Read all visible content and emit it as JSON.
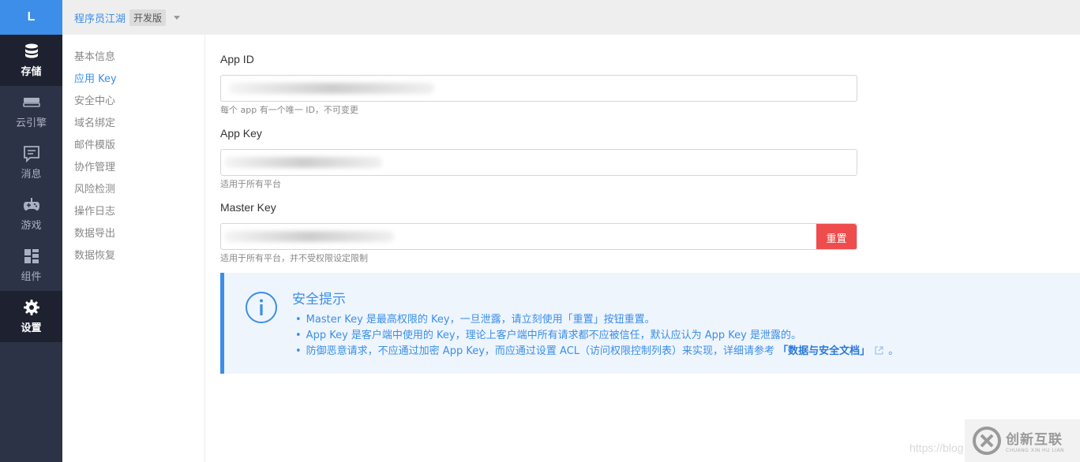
{
  "rail": {
    "logo": "L",
    "items": [
      {
        "label": "存储",
        "icon": "database-icon",
        "active": true
      },
      {
        "label": "云引擎",
        "icon": "cloud-engine-icon",
        "active": false
      },
      {
        "label": "消息",
        "icon": "message-icon",
        "active": false
      },
      {
        "label": "游戏",
        "icon": "gamepad-icon",
        "active": false
      },
      {
        "label": "组件",
        "icon": "components-icon",
        "active": false
      },
      {
        "label": "设置",
        "icon": "gear-icon",
        "active": true
      }
    ]
  },
  "topbar": {
    "app_name": "程序员江湖",
    "plan_badge": "开发版"
  },
  "subnav": {
    "items": [
      "基本信息",
      "应用 Key",
      "安全中心",
      "域名绑定",
      "邮件模版",
      "协作管理",
      "风险检测",
      "操作日志",
      "数据导出",
      "数据恢复"
    ],
    "active": "应用 Key"
  },
  "fields": {
    "app_id": {
      "label": "App ID",
      "help": "每个 app 有一个唯一 ID，不可变更"
    },
    "app_key": {
      "label": "App Key",
      "help": "适用于所有平台"
    },
    "master_key": {
      "label": "Master Key",
      "help": "适用于所有平台，并不受权限设定限制",
      "reset_label": "重置"
    }
  },
  "security_tip": {
    "icon": "info-circle-icon",
    "title": "安全提示",
    "items": [
      "Master Key 是最高权限的 Key，一旦泄露，请立刻使用「重置」按钮重置。",
      "App Key 是客户端中使用的 Key，理论上客户端中所有请求都不应被信任，默认应认为 App Key 是泄露的。"
    ],
    "item3_prefix": "防御恶意请求，不应通过加密 App Key，而应通过设置 ACL（访问权限控制列表）来实现，详细请参考",
    "item3_link": "「数据与安全文档」",
    "item3_suffix": "。"
  },
  "watermark": {
    "url_text": "https://blog",
    "brand_cn": "创新互联",
    "brand_en": "CHUANG XIN HU LIAN"
  },
  "colors": {
    "accent": "#3c8ee8",
    "rail_bg": "#2d3346",
    "danger": "#ef4d4d",
    "tip_bg": "#eef5fd"
  }
}
